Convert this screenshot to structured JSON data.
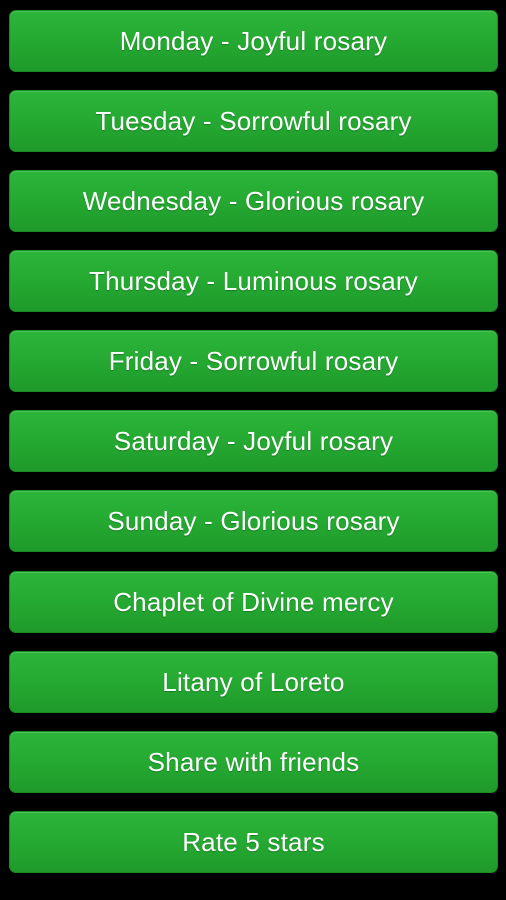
{
  "theme": {
    "background": "#000000",
    "button_color": "#24a831",
    "text_color": "#ffffff"
  },
  "menu": {
    "items": [
      {
        "label": "Monday - Joyful rosary"
      },
      {
        "label": "Tuesday - Sorrowful rosary"
      },
      {
        "label": "Wednesday - Glorious rosary"
      },
      {
        "label": "Thursday - Luminous rosary"
      },
      {
        "label": "Friday - Sorrowful rosary"
      },
      {
        "label": "Saturday - Joyful rosary"
      },
      {
        "label": "Sunday - Glorious rosary"
      },
      {
        "label": "Chaplet of Divine mercy"
      },
      {
        "label": "Litany of Loreto"
      },
      {
        "label": "Share with friends"
      },
      {
        "label": "Rate 5 stars"
      }
    ]
  }
}
